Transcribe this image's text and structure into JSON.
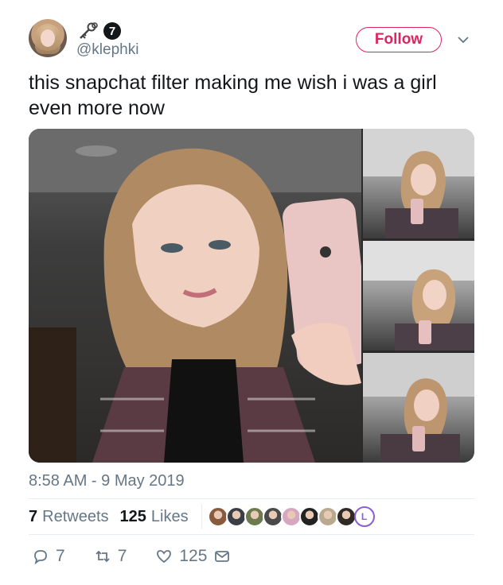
{
  "author": {
    "handle": "@klephki",
    "badge_number": "7",
    "key_icon": "key-icon"
  },
  "follow_button": {
    "label": "Follow",
    "color": "#e0245e"
  },
  "tweet": {
    "text": "this snapchat filter making me wish i was a girl even more now",
    "timestamp": "8:58 AM - 9 May 2019"
  },
  "stats": {
    "retweets_count": "7",
    "retweets_label": "Retweets",
    "likes_count": "125",
    "likes_label": "Likes",
    "liker_colors": [
      "#8a5a3c",
      "#3b3f45",
      "#6d7a4e",
      "#4a4a4a",
      "#d6a8c0",
      "#222222",
      "#b9a98f",
      "#2f2a26"
    ],
    "liker_more_letter": "L"
  },
  "actions": {
    "reply_count": "7",
    "retweet_count": "7",
    "like_count": "125"
  }
}
